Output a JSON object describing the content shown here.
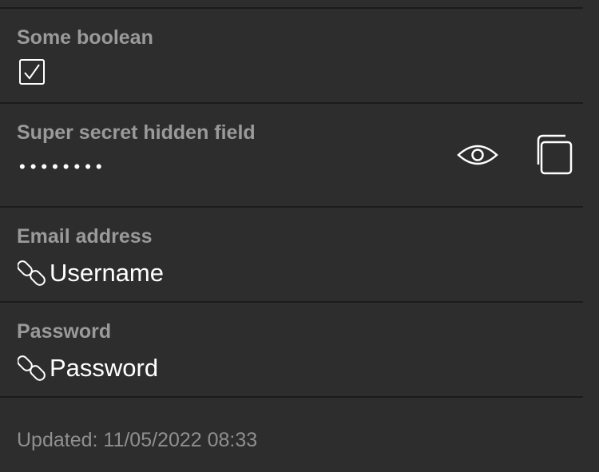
{
  "fields": {
    "boolean": {
      "label": "Some boolean",
      "checked": true
    },
    "hidden": {
      "label": "Super secret hidden field",
      "masked_value": "••••••••",
      "reveal_icon": "eye-icon",
      "copy_icon": "copy-icon"
    },
    "email": {
      "label": "Email address",
      "value": "Username",
      "icon": "link-icon"
    },
    "password": {
      "label": "Password",
      "value": "Password",
      "icon": "link-icon"
    }
  },
  "footer": {
    "updated": "Updated: 11/05/2022 08:33"
  },
  "colors": {
    "background": "#2d2d2d",
    "divider": "#1b1b1b",
    "label": "#9a9a9a",
    "text": "#ffffff"
  }
}
